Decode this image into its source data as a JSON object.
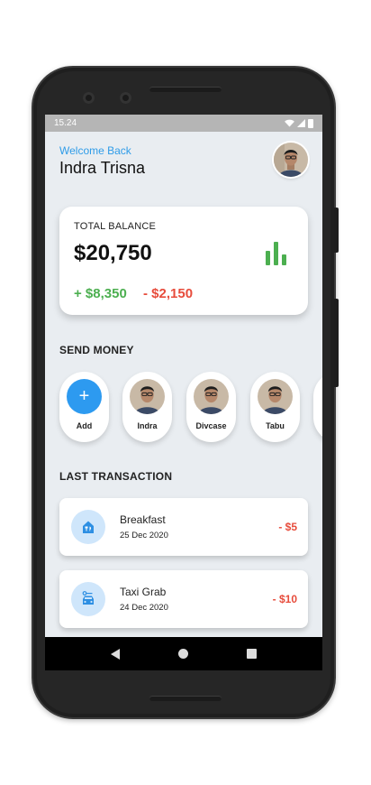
{
  "status_bar": {
    "time": "15.24"
  },
  "header": {
    "welcome": "Welcome Back",
    "user_name": "Indra Trisna"
  },
  "balance": {
    "label": "TOTAL BALANCE",
    "amount": "$20,750",
    "income": "+ $8,350",
    "expense": "- $2,150",
    "icon": "bar-chart-icon",
    "colors": {
      "income": "#4caf50",
      "expense": "#e74c3c"
    }
  },
  "send_money": {
    "title": "SEND MONEY",
    "contacts": [
      {
        "name": "Add",
        "icon": "plus-icon"
      },
      {
        "name": "Indra",
        "icon": "avatar"
      },
      {
        "name": "Divcase",
        "icon": "avatar"
      },
      {
        "name": "Tabu",
        "icon": "avatar"
      }
    ]
  },
  "last_transaction": {
    "title": "LAST TRANSACTION",
    "items": [
      {
        "title": "Breakfast",
        "date": "25 Dec 2020",
        "amount": "- $5",
        "icon": "restaurant-icon"
      },
      {
        "title": "Taxi Grab",
        "date": "24 Dec 2020",
        "amount": "- $10",
        "icon": "taxi-icon"
      }
    ]
  },
  "colors": {
    "accent": "#2d9af0",
    "background": "#e9edf1"
  }
}
